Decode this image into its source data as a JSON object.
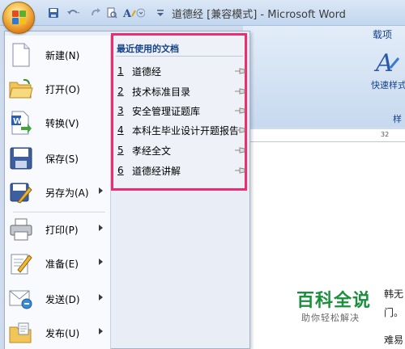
{
  "window": {
    "title": "道德经 [兼容模式] - Microsoft Word"
  },
  "ribbon": {
    "tab_partial": "载项",
    "style_button_label": "快速样式",
    "group_label_partial": "样",
    "ruler_number": "32"
  },
  "office_menu": {
    "items": [
      {
        "label": "新建(N)",
        "icon": "new-document-icon",
        "has_submenu": false
      },
      {
        "label": "打开(O)",
        "icon": "open-folder-icon",
        "has_submenu": false
      },
      {
        "label": "转换(V)",
        "icon": "convert-icon",
        "has_submenu": false
      },
      {
        "label": "保存(S)",
        "icon": "save-disk-icon",
        "has_submenu": false
      },
      {
        "label": "另存为(A)",
        "icon": "save-as-icon",
        "has_submenu": true
      },
      {
        "label": "打印(P)",
        "icon": "printer-icon",
        "has_submenu": true
      },
      {
        "label": "准备(E)",
        "icon": "prepare-icon",
        "has_submenu": true
      },
      {
        "label": "发送(D)",
        "icon": "send-icon",
        "has_submenu": true
      },
      {
        "label": "发布(U)",
        "icon": "publish-icon",
        "has_submenu": true
      }
    ]
  },
  "recent_documents": {
    "title": "最近使用的文档",
    "items": [
      {
        "num": "1",
        "name": "道德经"
      },
      {
        "num": "2",
        "name": "技术标准目录"
      },
      {
        "num": "3",
        "name": "安全管理证题库"
      },
      {
        "num": "4",
        "name": "本科生毕业设计开题报告"
      },
      {
        "num": "5",
        "name": "孝经全文"
      },
      {
        "num": "6",
        "name": "道德经讲解"
      }
    ]
  },
  "document_text": {
    "line1": "韩无",
    "line2": "门。",
    "line3": "难易"
  },
  "watermark": {
    "title": "百科全说",
    "subtitle": "助你轻松解决"
  },
  "colors": {
    "highlight_border": "#ef2c6e",
    "menu_text": "#15428b",
    "watermark_green": "#1a8f3c"
  }
}
